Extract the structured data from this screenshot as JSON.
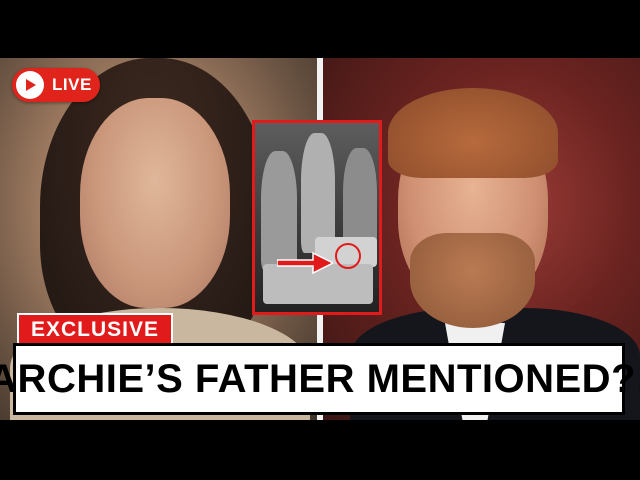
{
  "live_badge": {
    "label": "LIVE",
    "color": "#e0241b"
  },
  "tag": {
    "label": "EXCLUSIVE",
    "color": "#e11b1b"
  },
  "headline": {
    "text": "“ARCHIE’S FATHER MENTIONED?!”"
  },
  "icons": [
    "play-icon",
    "red-arrow-icon"
  ]
}
